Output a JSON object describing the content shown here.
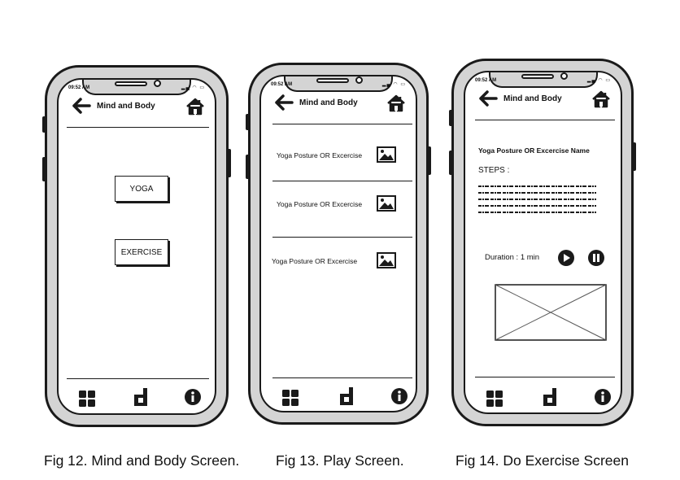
{
  "screens": [
    {
      "status_time": "09:52 AM",
      "header_title": "Mind and Body",
      "buttons": [
        "YOGA",
        "EXERCISE"
      ],
      "caption": "Fig 12. Mind and Body Screen."
    },
    {
      "status_time": "09:52 AM",
      "header_title": "Mind and Body",
      "rows": [
        "Yoga Posture OR Excercise",
        "Yoga Posture OR Excercise",
        "Yoga Posture OR Excercise"
      ],
      "caption": "Fig 13. Play Screen."
    },
    {
      "status_time": "09:52 AM",
      "header_title": "Mind and Body",
      "exercise_name": "Yoga Posture OR Excercise Name",
      "steps_label": "STEPS :",
      "duration_label": "Duration : 1 min",
      "caption": "Fig 14. Do Exercise Screen"
    }
  ],
  "icons": {
    "back": "back-arrow-icon",
    "home": "home-icon",
    "row_image": "image-icon",
    "play": "play-icon",
    "pause": "pause-icon",
    "nav": [
      "grid-icon",
      "d-logo-icon",
      "info-icon"
    ]
  },
  "colors": {
    "phone_frame": "#d4d4d4",
    "outline": "#1a1a1a",
    "screen": "#ffffff"
  }
}
